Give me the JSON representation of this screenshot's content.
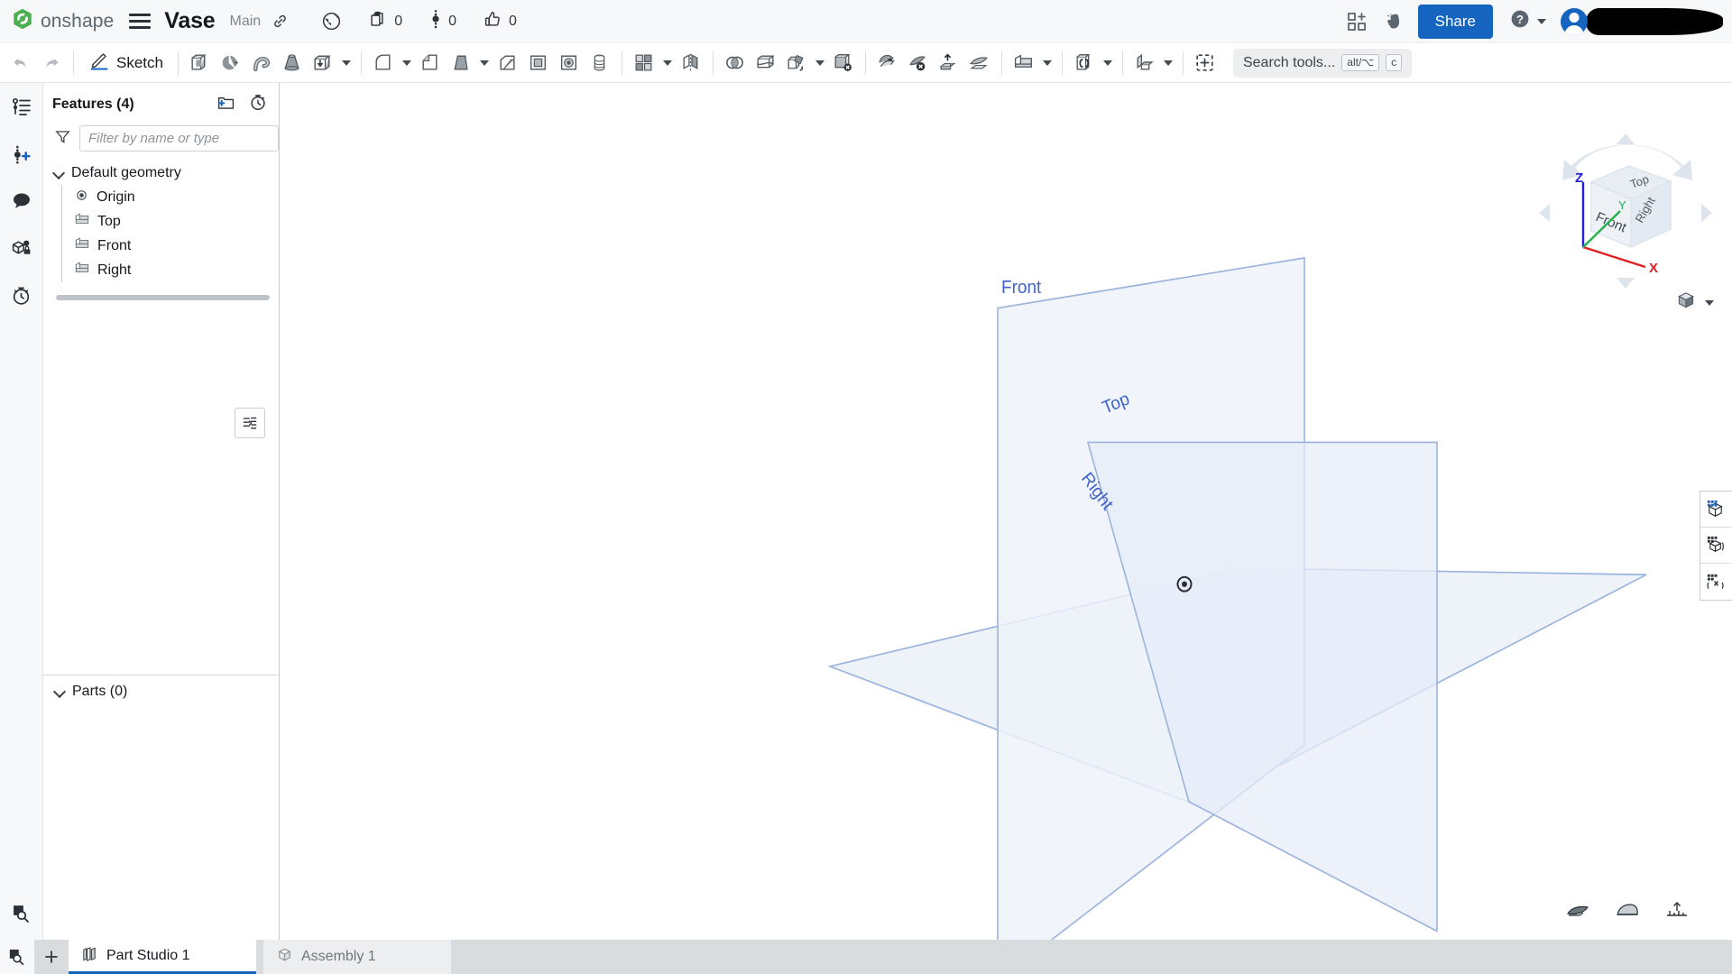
{
  "header": {
    "brand_name": "onshape",
    "brand_logo_icon": "onshape-logo-icon",
    "menu_icon": "hamburger-menu-icon",
    "document_title": "Vase",
    "branch_name": "Main",
    "link_icon": "link-icon",
    "globe_icon": "globe-public-icon",
    "copy_count": "0",
    "copy_icon": "copy-document-icon",
    "version_count": "0",
    "version_icon": "version-graph-icon",
    "like_count": "0",
    "like_icon": "thumbs-up-icon",
    "apps_icon": "add-app-grid-icon",
    "ai_icon": "ai-assistant-brain-icon",
    "share_label": "Share",
    "help_icon": "help-question-icon",
    "help_caret_icon": "chevron-down-icon",
    "avatar_icon": "user-avatar",
    "user_name_redacted": ""
  },
  "toolbar": {
    "undo_icon": "undo-arrow-icon",
    "redo_icon": "redo-arrow-icon",
    "sketch_icon": "sketch-pencil-icon",
    "sketch_label": "Sketch",
    "tools": [
      {
        "name": "extrude-icon",
        "caret": false
      },
      {
        "name": "revolve-icon",
        "caret": false
      },
      {
        "name": "sweep-icon",
        "caret": false
      },
      {
        "name": "loft-icon",
        "caret": false
      },
      {
        "name": "thicken-icon",
        "caret": true
      },
      {
        "name": "fillet-icon",
        "caret": true
      },
      {
        "name": "chamfer-icon",
        "caret": false
      },
      {
        "name": "draft-icon",
        "caret": true
      },
      {
        "name": "rib-icon",
        "caret": false
      },
      {
        "name": "shell-icon",
        "caret": false
      },
      {
        "name": "hole-icon",
        "caret": false
      },
      {
        "name": "thread-icon",
        "caret": false
      },
      {
        "name": "pattern-icon",
        "caret": true
      },
      {
        "name": "mirror-icon",
        "caret": false
      },
      {
        "name": "boolean-icon",
        "caret": false
      },
      {
        "name": "split-icon",
        "caret": false
      },
      {
        "name": "transform-icon",
        "caret": true
      },
      {
        "name": "delete-part-icon",
        "caret": false
      },
      {
        "name": "move-face-icon",
        "caret": false
      },
      {
        "name": "delete-face-icon",
        "caret": false
      },
      {
        "name": "replace-face-icon",
        "caret": false
      },
      {
        "name": "offset-surface-icon",
        "caret": false
      },
      {
        "name": "plane-icon",
        "caret": true
      },
      {
        "name": "variable-icon",
        "caret": true
      },
      {
        "name": "sheet-metal-icon",
        "caret": true
      },
      {
        "name": "insert-part-icon",
        "caret": false
      }
    ],
    "search_placeholder": "Search tools...",
    "search_icon": "search-tools-icon",
    "shortcut_modifier": "alt/⌥",
    "shortcut_key": "c"
  },
  "rail": {
    "items": [
      {
        "name": "feature-list-icon",
        "label": "Feature list"
      },
      {
        "name": "add-version-icon",
        "label": "Versions and history"
      },
      {
        "name": "comments-icon",
        "label": "Comments"
      },
      {
        "name": "part-permissions-icon",
        "label": "Where used"
      },
      {
        "name": "history-clock-icon",
        "label": "History"
      }
    ],
    "bottom_icon": "search-magnifier-icon"
  },
  "features_panel": {
    "title": "Features (4)",
    "new_folder_icon": "new-folder-icon",
    "rollback_icon": "rollback-stopwatch-icon",
    "filter_icon": "filter-funnel-icon",
    "filter_placeholder": "Filter by name or type",
    "filter_value": "",
    "group_label": "Default geometry",
    "group_chevron_icon": "chevron-down-icon",
    "items": [
      {
        "label": "Origin",
        "icon": "origin-point-icon"
      },
      {
        "label": "Top",
        "icon": "plane-icon"
      },
      {
        "label": "Front",
        "icon": "plane-icon"
      },
      {
        "label": "Right",
        "icon": "plane-icon"
      }
    ],
    "float_button_icon": "feature-list-toggle-icon",
    "parts_label": "Parts (0)",
    "parts_chevron_icon": "chevron-down-icon"
  },
  "canvas": {
    "origin_icon": "origin-marker-icon",
    "planes": [
      {
        "label": "Front",
        "name": "front-plane"
      },
      {
        "label": "Top",
        "name": "top-plane"
      },
      {
        "label": "Right",
        "name": "right-plane"
      }
    ],
    "plane_label_color": "#3f63c8",
    "plane_fill_color": "#eaeff8",
    "plane_edge_color": "#9bb4dd",
    "viewcube": {
      "face_top": "Top",
      "face_front": "Front",
      "face_right": "Right",
      "axis_x": "X",
      "axis_y": "Y",
      "axis_z": "Z",
      "axis_x_color": "#e02020",
      "axis_y_color": "#22b14c",
      "axis_z_color": "#2020e0",
      "view_dropdown_icon": "view-orientation-cube-icon",
      "view_dropdown_caret": "chevron-down-icon"
    },
    "right_tools": [
      {
        "name": "display-state-icon"
      },
      {
        "name": "render-mode-icon"
      },
      {
        "name": "explode-view-icon"
      }
    ],
    "bottom_tools": [
      {
        "name": "section-view-icon"
      },
      {
        "name": "display-mode-icon"
      },
      {
        "name": "measure-icon"
      }
    ]
  },
  "tabbar": {
    "search_tab_icon": "search-tab-icon",
    "add_tab_label": "+",
    "tabs": [
      {
        "label": "Part Studio 1",
        "icon": "part-studio-icon",
        "active": true
      },
      {
        "label": "Assembly 1",
        "icon": "assembly-icon",
        "active": false
      }
    ]
  },
  "colors": {
    "accent": "#1565c0",
    "header_bg": "#f7f8f9",
    "plane_blue": "#3f63c8"
  }
}
